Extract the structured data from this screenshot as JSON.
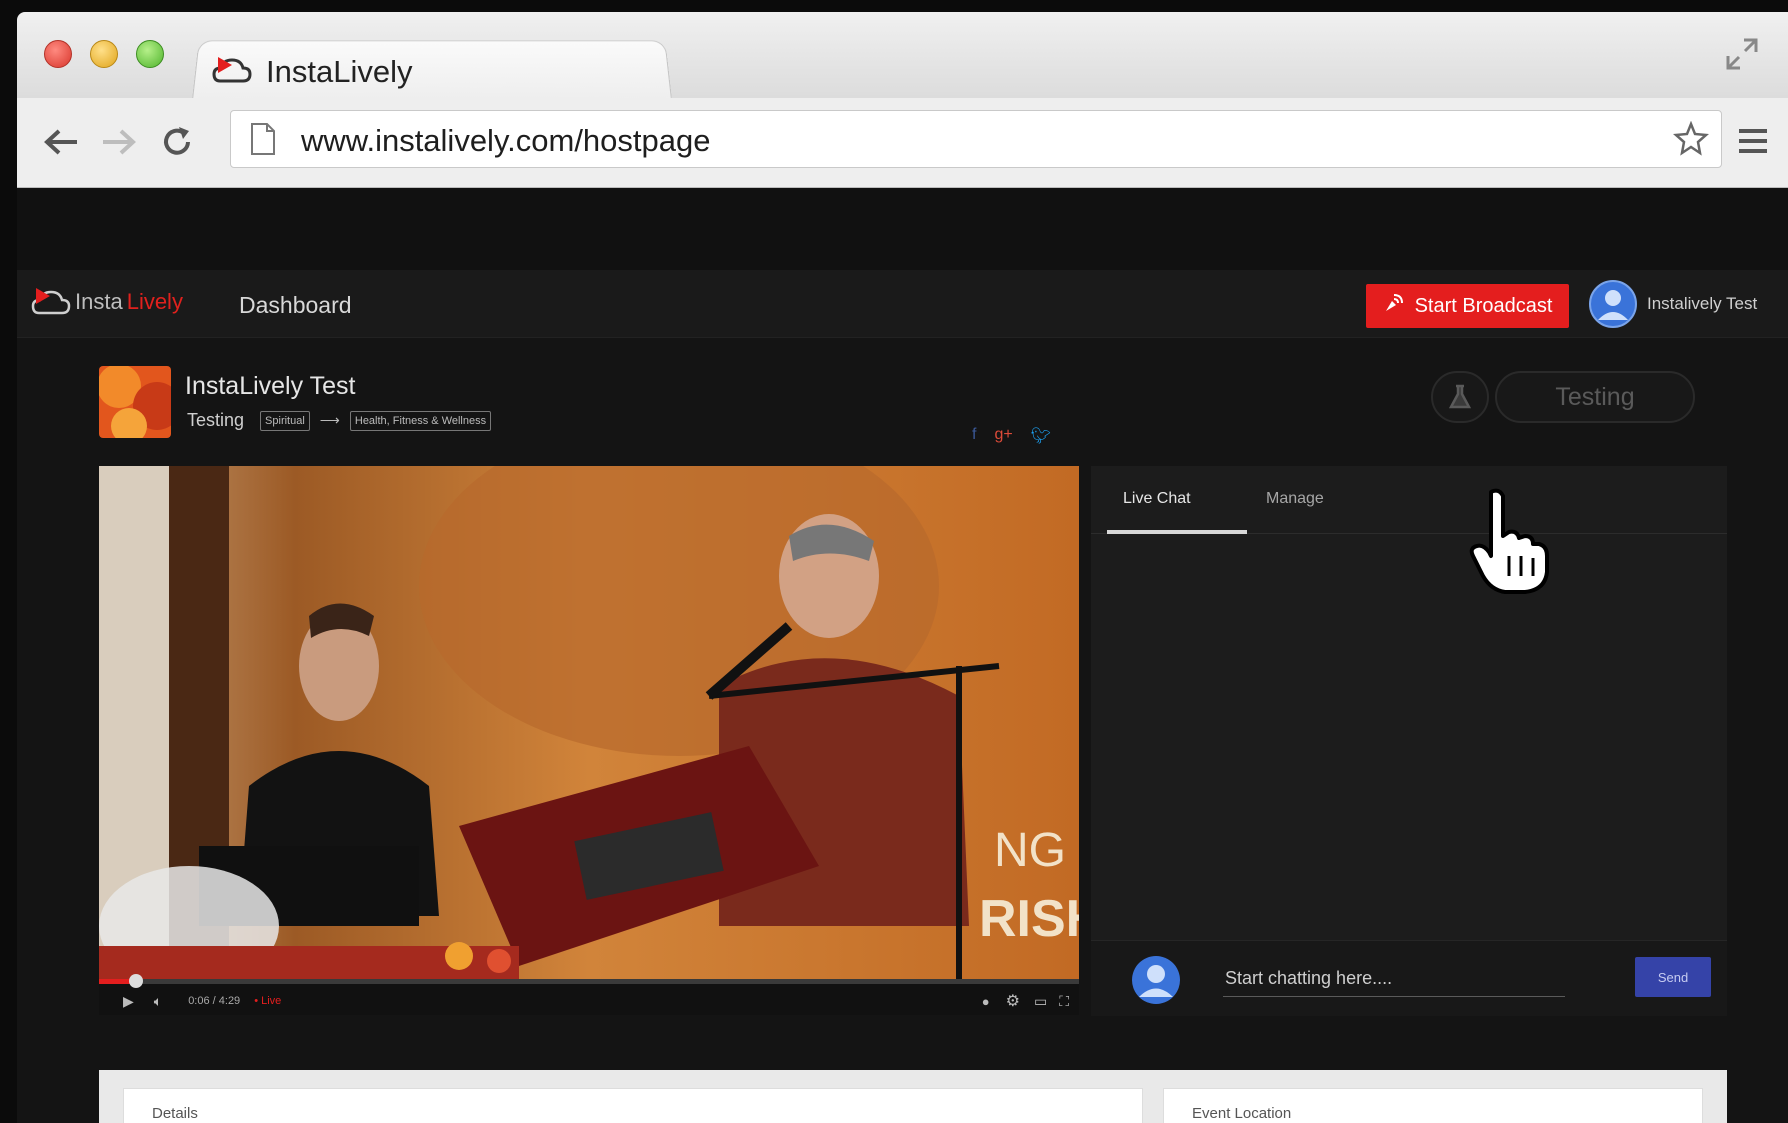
{
  "browser": {
    "tab_title": "InstaLively",
    "url": "www.instalively.com/hostpage"
  },
  "app": {
    "brand_insta": "Insta",
    "brand_lively": "Lively",
    "nav_dashboard": "Dashboard",
    "start_broadcast_label": "Start Broadcast",
    "user_name": "Instalively Test"
  },
  "channel": {
    "title": "InstaLively Test",
    "status": "Testing",
    "category": "Spiritual",
    "subcategory": "Health, Fitness & Wellness",
    "testing_label": "Testing"
  },
  "video": {
    "time": "0:06 / 4:29",
    "live_label": "• Live",
    "progress_percent": 4
  },
  "chat": {
    "tabs": [
      {
        "label": "Live Chat"
      },
      {
        "label": "Manage"
      }
    ],
    "placeholder": "Start chatting here....",
    "send_label": "Send"
  },
  "panels": {
    "details_label": "Details",
    "location_label": "Event Location"
  },
  "colors": {
    "brand_red": "#e41e1e",
    "send_blue": "#3543a8",
    "facebook": "#3b5998",
    "gplus": "#dd4b39",
    "twitter": "#1da1f2"
  }
}
